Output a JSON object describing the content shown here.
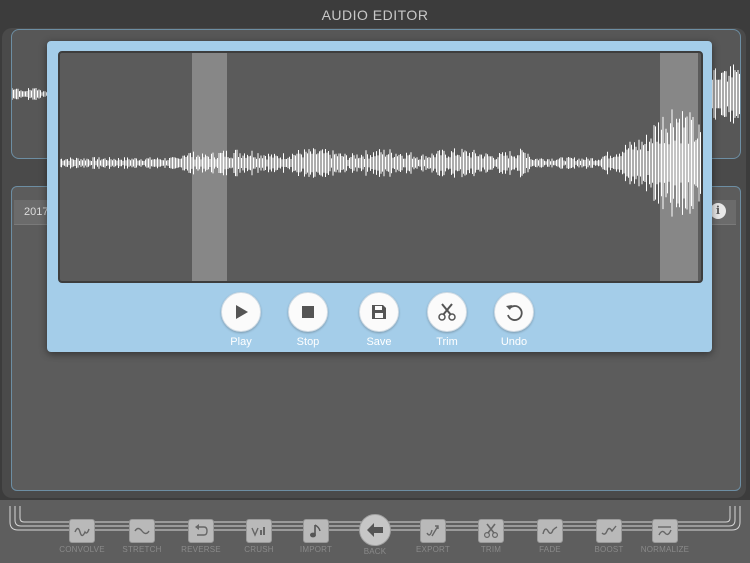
{
  "app": {
    "title": "AUDIO EDITOR"
  },
  "list": {
    "row_date": "2017"
  },
  "editor": {
    "controls": [
      {
        "label": "Play",
        "icon": "play-icon"
      },
      {
        "label": "Stop",
        "icon": "stop-icon"
      },
      {
        "label": "Save",
        "icon": "save-icon"
      },
      {
        "label": "Trim",
        "icon": "scissors-icon"
      },
      {
        "label": "Undo",
        "icon": "undo-icon"
      }
    ]
  },
  "toolbar": {
    "tools": [
      {
        "label": "CONVOLVE",
        "icon": "convolve-icon"
      },
      {
        "label": "STRETCH",
        "icon": "stretch-icon"
      },
      {
        "label": "REVERSE",
        "icon": "reverse-icon"
      },
      {
        "label": "CRUSH",
        "icon": "crush-icon"
      },
      {
        "label": "IMPORT",
        "icon": "music-note-icon"
      },
      {
        "label": "BACK",
        "icon": "back-arrow-icon"
      },
      {
        "label": "EXPORT",
        "icon": "export-icon"
      },
      {
        "label": "TRIM",
        "icon": "scissors-icon"
      },
      {
        "label": "FADE",
        "icon": "fade-icon"
      },
      {
        "label": "BOOST",
        "icon": "boost-icon"
      },
      {
        "label": "NORMALIZE",
        "icon": "normalize-icon"
      }
    ]
  }
}
